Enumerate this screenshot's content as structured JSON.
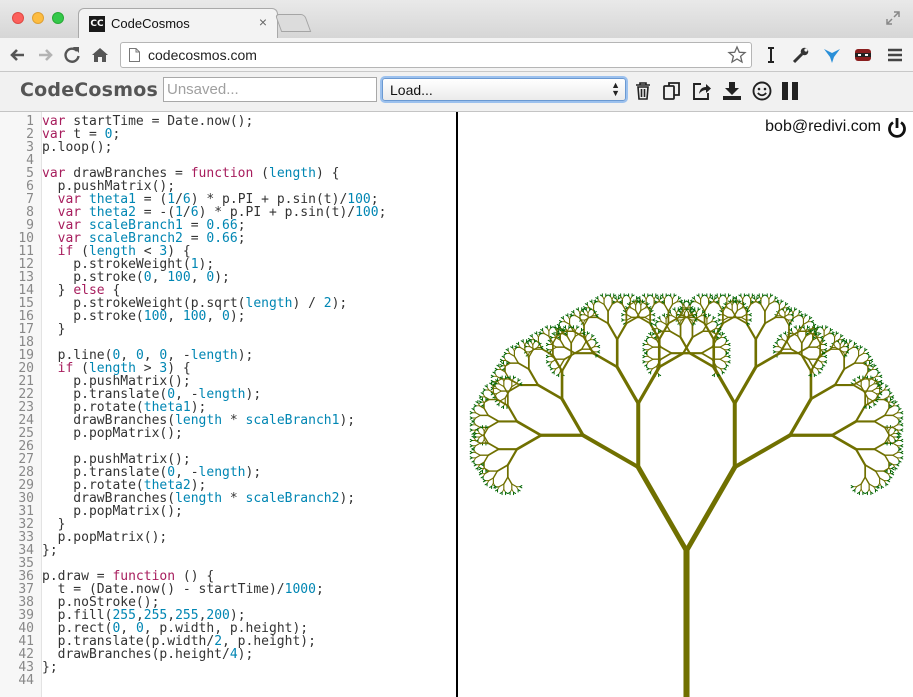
{
  "window": {
    "tab_title": "CodeCosmos",
    "favicon_text": "CC",
    "tab_close": "×"
  },
  "browser": {
    "url": "codecosmos.com",
    "icons": [
      "back-icon",
      "forward-icon",
      "reload-icon",
      "home-icon",
      "page-icon",
      "star-icon",
      "cursor-extension-icon",
      "wrench-extension-icon",
      "bird-extension-icon",
      "ninja-extension-icon",
      "menu-icon"
    ]
  },
  "app": {
    "title": "CodeCosmos",
    "name_placeholder": "Unsaved...",
    "load_label": "Load...",
    "load_arrows": "▲▼",
    "tools": [
      "trash-icon",
      "copy-icon",
      "share-icon",
      "download-icon",
      "smiley-icon",
      "pause-icon"
    ],
    "user_email": "bob@redivi.com"
  },
  "colors": {
    "tree_trunk": "#707000",
    "tree_leaf": "#006400",
    "keyword": "#a71d5d",
    "identifier": "#0086b3"
  },
  "editor": {
    "lines": [
      [
        [
          "k",
          "var"
        ],
        [
          "p",
          " startTime = Date.now();"
        ]
      ],
      [
        [
          "k",
          "var"
        ],
        [
          "p",
          " t = "
        ],
        [
          "num",
          "0"
        ],
        [
          "p",
          ";"
        ]
      ],
      [
        [
          "p",
          "p.loop();"
        ]
      ],
      [],
      [
        [
          "k",
          "var"
        ],
        [
          "p",
          " drawBranches = "
        ],
        [
          "k",
          "function"
        ],
        [
          "p",
          " ("
        ],
        [
          "n",
          "length"
        ],
        [
          "p",
          ") {"
        ]
      ],
      [
        [
          "p",
          "  p.pushMatrix();"
        ]
      ],
      [
        [
          "p",
          "  "
        ],
        [
          "k",
          "var"
        ],
        [
          "p",
          " "
        ],
        [
          "n",
          "theta1"
        ],
        [
          "p",
          " = ("
        ],
        [
          "num",
          "1"
        ],
        [
          "p",
          "/"
        ],
        [
          "num",
          "6"
        ],
        [
          "p",
          ") * p.PI + p.sin(t)/"
        ],
        [
          "num",
          "100"
        ],
        [
          "p",
          ";"
        ]
      ],
      [
        [
          "p",
          "  "
        ],
        [
          "k",
          "var"
        ],
        [
          "p",
          " "
        ],
        [
          "n",
          "theta2"
        ],
        [
          "p",
          " = -("
        ],
        [
          "num",
          "1"
        ],
        [
          "p",
          "/"
        ],
        [
          "num",
          "6"
        ],
        [
          "p",
          ") * p.PI + p.sin(t)/"
        ],
        [
          "num",
          "100"
        ],
        [
          "p",
          ";"
        ]
      ],
      [
        [
          "p",
          "  "
        ],
        [
          "k",
          "var"
        ],
        [
          "p",
          " "
        ],
        [
          "n",
          "scaleBranch1"
        ],
        [
          "p",
          " = "
        ],
        [
          "num",
          "0.66"
        ],
        [
          "p",
          ";"
        ]
      ],
      [
        [
          "p",
          "  "
        ],
        [
          "k",
          "var"
        ],
        [
          "p",
          " "
        ],
        [
          "n",
          "scaleBranch2"
        ],
        [
          "p",
          " = "
        ],
        [
          "num",
          "0.66"
        ],
        [
          "p",
          ";"
        ]
      ],
      [
        [
          "p",
          "  "
        ],
        [
          "k",
          "if"
        ],
        [
          "p",
          " ("
        ],
        [
          "n",
          "length"
        ],
        [
          "p",
          " < "
        ],
        [
          "num",
          "3"
        ],
        [
          "p",
          ") {"
        ]
      ],
      [
        [
          "p",
          "    p.strokeWeight("
        ],
        [
          "num",
          "1"
        ],
        [
          "p",
          ");"
        ]
      ],
      [
        [
          "p",
          "    p.stroke("
        ],
        [
          "num",
          "0"
        ],
        [
          "p",
          ", "
        ],
        [
          "num",
          "100"
        ],
        [
          "p",
          ", "
        ],
        [
          "num",
          "0"
        ],
        [
          "p",
          ");"
        ]
      ],
      [
        [
          "p",
          "  } "
        ],
        [
          "k",
          "else"
        ],
        [
          "p",
          " {"
        ]
      ],
      [
        [
          "p",
          "    p.strokeWeight(p.sqrt("
        ],
        [
          "n",
          "length"
        ],
        [
          "p",
          ") / "
        ],
        [
          "num",
          "2"
        ],
        [
          "p",
          ");"
        ]
      ],
      [
        [
          "p",
          "    p.stroke("
        ],
        [
          "num",
          "100"
        ],
        [
          "p",
          ", "
        ],
        [
          "num",
          "100"
        ],
        [
          "p",
          ", "
        ],
        [
          "num",
          "0"
        ],
        [
          "p",
          ");"
        ]
      ],
      [
        [
          "p",
          "  }"
        ]
      ],
      [],
      [
        [
          "p",
          "  p.line("
        ],
        [
          "num",
          "0"
        ],
        [
          "p",
          ", "
        ],
        [
          "num",
          "0"
        ],
        [
          "p",
          ", "
        ],
        [
          "num",
          "0"
        ],
        [
          "p",
          ", -"
        ],
        [
          "n",
          "length"
        ],
        [
          "p",
          ");"
        ]
      ],
      [
        [
          "p",
          "  "
        ],
        [
          "k",
          "if"
        ],
        [
          "p",
          " ("
        ],
        [
          "n",
          "length"
        ],
        [
          "p",
          " > "
        ],
        [
          "num",
          "3"
        ],
        [
          "p",
          ") {"
        ]
      ],
      [
        [
          "p",
          "    p.pushMatrix();"
        ]
      ],
      [
        [
          "p",
          "    p.translate("
        ],
        [
          "num",
          "0"
        ],
        [
          "p",
          ", -"
        ],
        [
          "n",
          "length"
        ],
        [
          "p",
          ");"
        ]
      ],
      [
        [
          "p",
          "    p.rotate("
        ],
        [
          "n",
          "theta1"
        ],
        [
          "p",
          ");"
        ]
      ],
      [
        [
          "p",
          "    drawBranches("
        ],
        [
          "n",
          "length"
        ],
        [
          "p",
          " * "
        ],
        [
          "n",
          "scaleBranch1"
        ],
        [
          "p",
          ");"
        ]
      ],
      [
        [
          "p",
          "    p.popMatrix();"
        ]
      ],
      [],
      [
        [
          "p",
          "    p.pushMatrix();"
        ]
      ],
      [
        [
          "p",
          "    p.translate("
        ],
        [
          "num",
          "0"
        ],
        [
          "p",
          ", -"
        ],
        [
          "n",
          "length"
        ],
        [
          "p",
          ");"
        ]
      ],
      [
        [
          "p",
          "    p.rotate("
        ],
        [
          "n",
          "theta2"
        ],
        [
          "p",
          ");"
        ]
      ],
      [
        [
          "p",
          "    drawBranches("
        ],
        [
          "n",
          "length"
        ],
        [
          "p",
          " * "
        ],
        [
          "n",
          "scaleBranch2"
        ],
        [
          "p",
          ");"
        ]
      ],
      [
        [
          "p",
          "    p.popMatrix();"
        ]
      ],
      [
        [
          "p",
          "  }"
        ]
      ],
      [
        [
          "p",
          "  p.popMatrix();"
        ]
      ],
      [
        [
          "p",
          "};"
        ]
      ],
      [],
      [
        [
          "p",
          "p.draw = "
        ],
        [
          "k",
          "function"
        ],
        [
          "p",
          " () {"
        ]
      ],
      [
        [
          "p",
          "  t = (Date.now() - startTime)/"
        ],
        [
          "num",
          "1000"
        ],
        [
          "p",
          ";"
        ]
      ],
      [
        [
          "p",
          "  p.noStroke();"
        ]
      ],
      [
        [
          "p",
          "  p.fill("
        ],
        [
          "num",
          "255"
        ],
        [
          "p",
          ","
        ],
        [
          "num",
          "255"
        ],
        [
          "p",
          ","
        ],
        [
          "num",
          "255"
        ],
        [
          "p",
          ","
        ],
        [
          "num",
          "200"
        ],
        [
          "p",
          ");"
        ]
      ],
      [
        [
          "p",
          "  p.rect("
        ],
        [
          "num",
          "0"
        ],
        [
          "p",
          ", "
        ],
        [
          "num",
          "0"
        ],
        [
          "p",
          ", p.width, p.height);"
        ]
      ],
      [
        [
          "p",
          "  p.translate(p.width/"
        ],
        [
          "num",
          "2"
        ],
        [
          "p",
          ", p.height);"
        ]
      ],
      [
        [
          "p",
          "  drawBranches(p.height/"
        ],
        [
          "num",
          "4"
        ],
        [
          "p",
          ");"
        ]
      ],
      [
        [
          "p",
          "};"
        ]
      ],
      []
    ]
  }
}
